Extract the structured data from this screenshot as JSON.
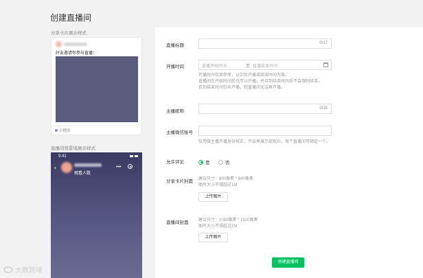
{
  "page": {
    "title": "创建直播间"
  },
  "preview": {
    "share_card_label": "分享卡片展示样式",
    "invite_text": "好友邀请你参与直播：",
    "mini_program_label": "小程序",
    "background_label": "直播间背景墙展示样式",
    "phone_time": "9:41",
    "viewers_label": "观看人数",
    "more_glyph": "•••",
    "cover_color": "#5b5b7e"
  },
  "form": {
    "title_label": "直播标题",
    "title_counter": "0/17",
    "time_label": "开播时间",
    "start_placeholder": "直播开始时间",
    "time_separator": "至",
    "end_placeholder": "直播结束时间",
    "time_hint_1": "开播时间仅供参考，以实际开播或结束时间为准。",
    "time_hint_2": "直播间在开始时间前也可以开播，并且到结束时间后不会强制结束。",
    "time_hint_3": "若到结束时间仍未开播，则直播间无法再开播。",
    "anchor_label": "主播昵称",
    "anchor_counter": "0/15",
    "wechat_label": "主播微信账号",
    "wechat_hint": "仅用做主播开播身份核实，不会再展示给观众。每个直播间可绑定一个。",
    "comment_label": "允许评论",
    "comment_yes": "是",
    "comment_no": "否",
    "share_cover_label": "分享卡片封面",
    "share_cover_hint_1": "建议尺寸：800像素 * 640像素",
    "share_cover_hint_2": "图片大小不得超过1M",
    "upload_label": "上传图片",
    "room_cover_label": "直播间封面",
    "room_cover_hint_1": "建议尺寸：1080像素 * 1920像素",
    "room_cover_hint_2": "图片大小不得超过2M",
    "upload_label_2": "上传图片",
    "create_button": "创建直播间",
    "accent_color": "#07c160"
  },
  "watermark": {
    "text": "大数跨境"
  }
}
